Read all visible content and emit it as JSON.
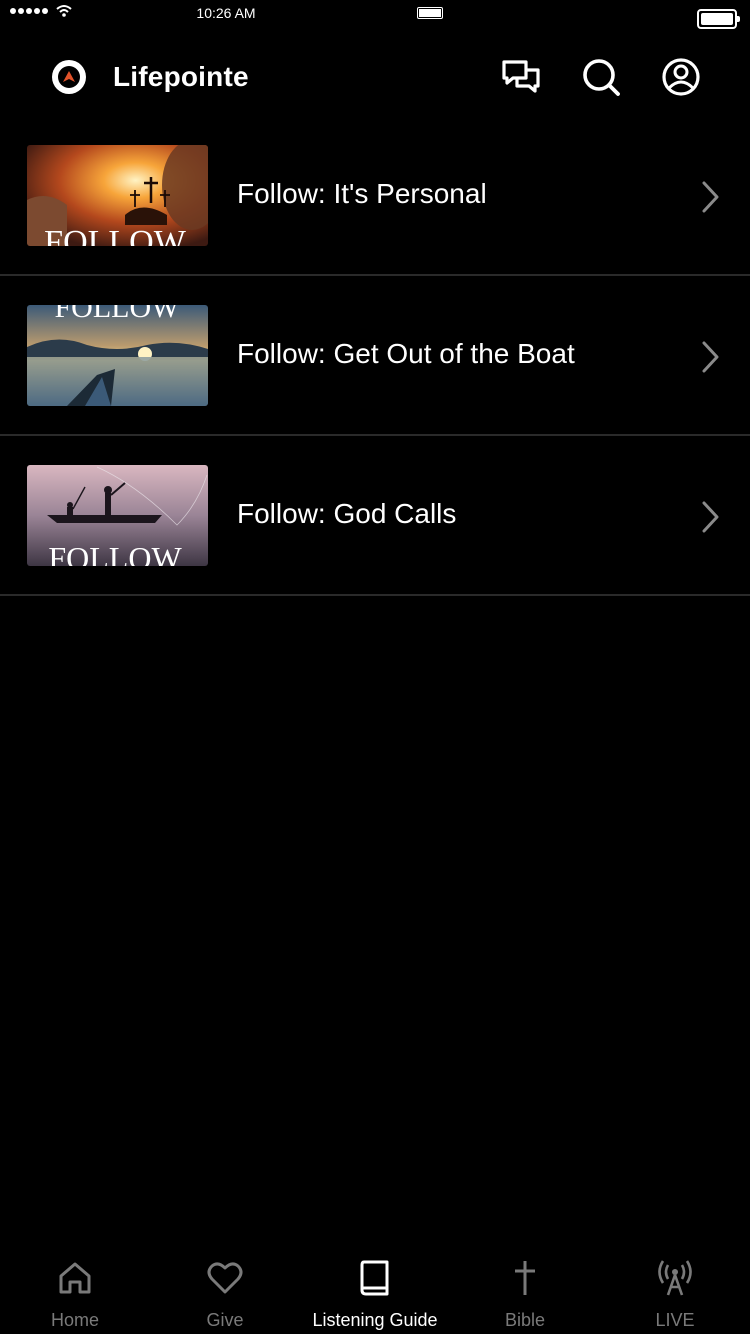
{
  "status_bar": {
    "time": "10:26 AM"
  },
  "header": {
    "brand": "Lifepointe",
    "icons": [
      "chat-icon",
      "search-icon",
      "profile-icon"
    ]
  },
  "list": {
    "items": [
      {
        "title": "Follow: It's Personal",
        "thumb_text": "FOLLOW"
      },
      {
        "title": "Follow: Get Out of the Boat",
        "thumb_text": "FOLLOW"
      },
      {
        "title": "Follow: God Calls",
        "thumb_text": "FOLLOW"
      }
    ]
  },
  "tabbar": {
    "tabs": [
      {
        "label": "Home",
        "icon": "home-icon",
        "active": false
      },
      {
        "label": "Give",
        "icon": "heart-icon",
        "active": false
      },
      {
        "label": "Listening Guide",
        "icon": "book-icon",
        "active": true
      },
      {
        "label": "Bible",
        "icon": "cross-icon",
        "active": false
      },
      {
        "label": "LIVE",
        "icon": "broadcast-icon",
        "active": false
      }
    ]
  },
  "colors": {
    "background": "#000000",
    "accent": "#e0522a",
    "inactive": "#7a7a7a",
    "divider": "#2a2a2a"
  }
}
